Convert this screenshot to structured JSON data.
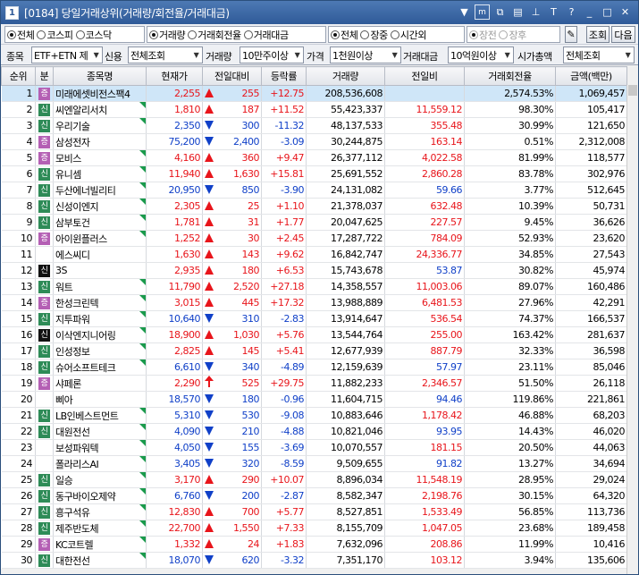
{
  "window": {
    "index": "1",
    "title": "[0184] 당일거래상위(거래량/회전율/거래대금)",
    "icons": [
      "down-arrow-icon",
      "m-icon",
      "link-icon",
      "screen-icon",
      "pin-icon",
      "font-icon",
      "help-icon",
      "minimize-icon",
      "maximize-icon",
      "close-icon"
    ]
  },
  "market_radios": [
    {
      "label": "전체",
      "checked": true
    },
    {
      "label": "코스피",
      "checked": false
    },
    {
      "label": "코스닥",
      "checked": false
    }
  ],
  "sort_radios": [
    {
      "label": "거래량",
      "checked": true
    },
    {
      "label": "거래회전율",
      "checked": false
    },
    {
      "label": "거래대금",
      "checked": false
    }
  ],
  "time_radios": [
    {
      "label": "전체",
      "checked": true,
      "disabled": false
    },
    {
      "label": "장중",
      "checked": false,
      "disabled": false
    },
    {
      "label": "시간외",
      "checked": false,
      "disabled": false
    }
  ],
  "session_radios": [
    {
      "label": "장전",
      "checked": true,
      "disabled": true
    },
    {
      "label": "장후",
      "checked": false,
      "disabled": true
    }
  ],
  "buttons": {
    "search": "조회",
    "next": "다음"
  },
  "filters": {
    "item_label": "종목",
    "item_value": "ETF+ETN 제",
    "credit_label": "신용",
    "credit_value": "전체조회",
    "volume_label": "거래량",
    "volume_value": "10만주이상",
    "price_label": "가격",
    "price_value": "1천원이상",
    "amount_label": "거래대금",
    "amount_value": "10억원이상",
    "mcap_label": "시가총액",
    "mcap_value": "전체조회"
  },
  "columns": [
    "순위",
    "분",
    "종목명",
    "현재가",
    "전일대비",
    "등락률",
    "거래량",
    "전일비",
    "거래회전율",
    "금액(백만)"
  ],
  "rows": [
    {
      "rank": "1",
      "cls": "증",
      "name": "미래에셋비전스팩4",
      "flag": false,
      "price": "2,255",
      "dir": "up",
      "chg": "255",
      "rate": "+12.75",
      "vol": "208,536,608",
      "prev": "",
      "turn": "2,574.53%",
      "amt": "1,069,457"
    },
    {
      "rank": "2",
      "cls": "신",
      "name": "씨엔알리서치",
      "flag": true,
      "price": "1,810",
      "dir": "up",
      "chg": "187",
      "rate": "+11.52",
      "vol": "55,423,337",
      "prev": "11,559.12",
      "turn": "98.30%",
      "amt": "105,417"
    },
    {
      "rank": "3",
      "cls": "신",
      "name": "우리기술",
      "flag": true,
      "price": "2,350",
      "dir": "down",
      "chg": "300",
      "rate": "-11.32",
      "vol": "48,137,533",
      "prev": "355.48",
      "turn": "30.99%",
      "amt": "121,650"
    },
    {
      "rank": "4",
      "cls": "증",
      "name": "삼성전자",
      "flag": false,
      "price": "75,200",
      "dir": "down",
      "chg": "2,400",
      "rate": "-3.09",
      "vol": "30,244,875",
      "prev": "163.14",
      "turn": "0.51%",
      "amt": "2,312,008"
    },
    {
      "rank": "5",
      "cls": "증",
      "name": "모비스",
      "flag": true,
      "price": "4,160",
      "dir": "up",
      "chg": "360",
      "rate": "+9.47",
      "vol": "26,377,112",
      "prev": "4,022.58",
      "turn": "81.99%",
      "amt": "118,577"
    },
    {
      "rank": "6",
      "cls": "신",
      "name": "유니셈",
      "flag": true,
      "price": "11,940",
      "dir": "up",
      "chg": "1,630",
      "rate": "+15.81",
      "vol": "25,691,552",
      "prev": "2,860.28",
      "turn": "83.78%",
      "amt": "302,976"
    },
    {
      "rank": "7",
      "cls": "신",
      "name": "두산에너빌리티",
      "flag": true,
      "price": "20,950",
      "dir": "down",
      "chg": "850",
      "rate": "-3.90",
      "vol": "24,131,082",
      "prev": "59.66",
      "turn": "3.77%",
      "amt": "512,645"
    },
    {
      "rank": "8",
      "cls": "신",
      "name": "신성이엔지",
      "flag": true,
      "price": "2,305",
      "dir": "up",
      "chg": "25",
      "rate": "+1.10",
      "vol": "21,378,037",
      "prev": "632.48",
      "turn": "10.39%",
      "amt": "50,731"
    },
    {
      "rank": "9",
      "cls": "신",
      "name": "삼부토건",
      "flag": true,
      "price": "1,781",
      "dir": "up",
      "chg": "31",
      "rate": "+1.77",
      "vol": "20,047,625",
      "prev": "227.57",
      "turn": "9.45%",
      "amt": "36,626"
    },
    {
      "rank": "10",
      "cls": "증",
      "name": "아이윈플러스",
      "flag": true,
      "price": "1,252",
      "dir": "up",
      "chg": "30",
      "rate": "+2.45",
      "vol": "17,287,722",
      "prev": "784.09",
      "turn": "52.93%",
      "amt": "23,620"
    },
    {
      "rank": "11",
      "cls": "",
      "name": "에스씨디",
      "flag": false,
      "price": "1,630",
      "dir": "up",
      "chg": "143",
      "rate": "+9.62",
      "vol": "16,842,747",
      "prev": "24,336.77",
      "turn": "34.85%",
      "amt": "27,543"
    },
    {
      "rank": "12",
      "cls": "신k",
      "name": "3S",
      "flag": false,
      "price": "2,935",
      "dir": "up",
      "chg": "180",
      "rate": "+6.53",
      "vol": "15,743,678",
      "prev": "53.87",
      "turn": "30.82%",
      "amt": "45,974"
    },
    {
      "rank": "13",
      "cls": "신",
      "name": "워트",
      "flag": true,
      "price": "11,790",
      "dir": "up",
      "chg": "2,520",
      "rate": "+27.18",
      "vol": "14,358,557",
      "prev": "11,003.06",
      "turn": "89.07%",
      "amt": "160,486"
    },
    {
      "rank": "14",
      "cls": "증",
      "name": "한성크린텍",
      "flag": true,
      "price": "3,015",
      "dir": "up",
      "chg": "445",
      "rate": "+17.32",
      "vol": "13,988,889",
      "prev": "6,481.53",
      "turn": "27.96%",
      "amt": "42,291"
    },
    {
      "rank": "15",
      "cls": "신",
      "name": "지투파워",
      "flag": true,
      "price": "10,640",
      "dir": "down",
      "chg": "310",
      "rate": "-2.83",
      "vol": "13,914,647",
      "prev": "536.54",
      "turn": "74.37%",
      "amt": "166,537"
    },
    {
      "rank": "16",
      "cls": "신k",
      "name": "이삭엔지니어링",
      "flag": true,
      "price": "18,900",
      "dir": "up",
      "chg": "1,030",
      "rate": "+5.76",
      "vol": "13,544,764",
      "prev": "255.00",
      "turn": "163.42%",
      "amt": "281,637"
    },
    {
      "rank": "17",
      "cls": "신",
      "name": "인성정보",
      "flag": true,
      "price": "2,825",
      "dir": "up",
      "chg": "145",
      "rate": "+5.41",
      "vol": "12,677,939",
      "prev": "887.79",
      "turn": "32.33%",
      "amt": "36,598"
    },
    {
      "rank": "18",
      "cls": "신",
      "name": "슈어소프트테크",
      "flag": true,
      "price": "6,610",
      "dir": "down",
      "chg": "340",
      "rate": "-4.89",
      "vol": "12,159,639",
      "prev": "57.97",
      "turn": "23.11%",
      "amt": "85,046"
    },
    {
      "rank": "19",
      "cls": "증",
      "name": "샤페론",
      "flag": false,
      "price": "2,290",
      "dir": "uparrow",
      "chg": "525",
      "rate": "+29.75",
      "vol": "11,882,233",
      "prev": "2,346.57",
      "turn": "51.50%",
      "amt": "26,118"
    },
    {
      "rank": "20",
      "cls": "",
      "name": "삐아",
      "flag": false,
      "price": "18,570",
      "dir": "down",
      "chg": "180",
      "rate": "-0.96",
      "vol": "11,604,715",
      "prev": "94.46",
      "turn": "119.86%",
      "amt": "221,861"
    },
    {
      "rank": "21",
      "cls": "신",
      "name": "LB인베스트먼트",
      "flag": true,
      "price": "5,310",
      "dir": "down",
      "chg": "530",
      "rate": "-9.08",
      "vol": "10,883,646",
      "prev": "1,178.42",
      "turn": "46.88%",
      "amt": "68,203"
    },
    {
      "rank": "22",
      "cls": "신",
      "name": "대원전선",
      "flag": true,
      "price": "4,090",
      "dir": "down",
      "chg": "210",
      "rate": "-4.88",
      "vol": "10,821,046",
      "prev": "93.95",
      "turn": "14.43%",
      "amt": "46,020"
    },
    {
      "rank": "23",
      "cls": "",
      "name": "보성파워텍",
      "flag": true,
      "price": "4,050",
      "dir": "down",
      "chg": "155",
      "rate": "-3.69",
      "vol": "10,070,557",
      "prev": "181.15",
      "turn": "20.50%",
      "amt": "44,063"
    },
    {
      "rank": "24",
      "cls": "",
      "name": "폴라리스AI",
      "flag": true,
      "price": "3,405",
      "dir": "down",
      "chg": "320",
      "rate": "-8.59",
      "vol": "9,509,655",
      "prev": "91.82",
      "turn": "13.27%",
      "amt": "34,694"
    },
    {
      "rank": "25",
      "cls": "신",
      "name": "일승",
      "flag": true,
      "price": "3,170",
      "dir": "up",
      "chg": "290",
      "rate": "+10.07",
      "vol": "8,896,034",
      "prev": "11,548.19",
      "turn": "28.95%",
      "amt": "29,024"
    },
    {
      "rank": "26",
      "cls": "신",
      "name": "동구바이오제약",
      "flag": true,
      "price": "6,760",
      "dir": "down",
      "chg": "200",
      "rate": "-2.87",
      "vol": "8,582,347",
      "prev": "2,198.76",
      "turn": "30.15%",
      "amt": "64,320"
    },
    {
      "rank": "27",
      "cls": "신",
      "name": "흥구석유",
      "flag": true,
      "price": "12,830",
      "dir": "up",
      "chg": "700",
      "rate": "+5.77",
      "vol": "8,527,851",
      "prev": "1,533.49",
      "turn": "56.85%",
      "amt": "113,736"
    },
    {
      "rank": "28",
      "cls": "신",
      "name": "제주반도체",
      "flag": true,
      "price": "22,700",
      "dir": "up",
      "chg": "1,550",
      "rate": "+7.33",
      "vol": "8,155,709",
      "prev": "1,047.05",
      "turn": "23.68%",
      "amt": "189,458"
    },
    {
      "rank": "29",
      "cls": "증",
      "name": "KC코트렐",
      "flag": true,
      "price": "1,332",
      "dir": "up",
      "chg": "24",
      "rate": "+1.83",
      "vol": "7,632,096",
      "prev": "208.86",
      "turn": "11.99%",
      "amt": "10,416"
    },
    {
      "rank": "30",
      "cls": "신",
      "name": "대한전선",
      "flag": true,
      "price": "18,070",
      "dir": "down",
      "chg": "620",
      "rate": "-3.32",
      "vol": "7,351,170",
      "prev": "103.12",
      "turn": "3.94%",
      "amt": "135,606"
    }
  ],
  "colors": {
    "up": "#e8151b",
    "down": "#1040c8",
    "badge_shin": "#2e8b57",
    "badge_jeung": "#b45fb4",
    "badge_shin_k": "#111111",
    "flag": "#1a9a4c",
    "selected_row": "#cfe6f8"
  }
}
